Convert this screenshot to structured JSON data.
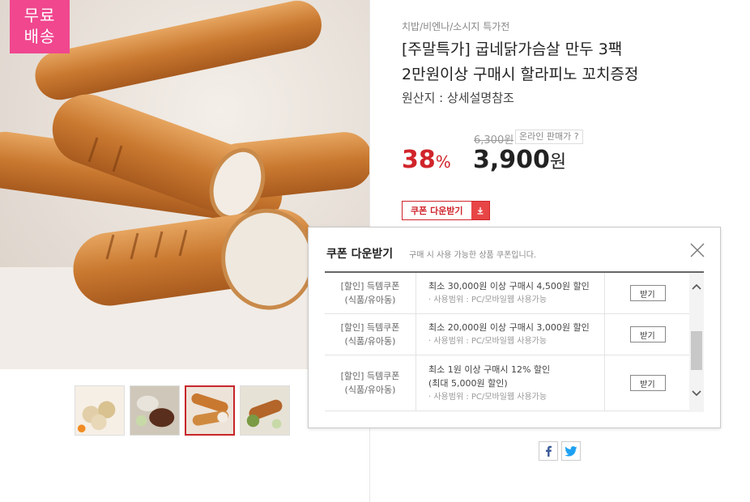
{
  "badge": {
    "free_shipping_line1": "무료",
    "free_shipping_line2": "배송"
  },
  "product": {
    "category": "치밥/비엔나/소시지 특가전",
    "title_line1": "[주말특가] 굽네닭가슴살 만두 3팩",
    "title_line2": "2만원이상 구매시 할라피노 꼬치증정",
    "origin": "원산지 : 상세설명참조",
    "original_price": "6,300원",
    "online_price_label": "온라인 판매가 ?",
    "discount_value": "38",
    "discount_unit": "%",
    "price_value": "3,900",
    "price_unit": "원",
    "coupon_button_label": "쿠폰 다운받기",
    "thumbnails": [
      "thumb-1",
      "thumb-2",
      "thumb-3",
      "thumb-4"
    ],
    "active_thumbnail": 3
  },
  "popup": {
    "title": "쿠폰 다운받기",
    "subtitle": "구매 시 사용 가능한 상품 쿠폰입니다.",
    "coupons": [
      {
        "name_line1": "[할인] 득템쿠폰",
        "name_line2": "(식품/유아동)",
        "desc_line1": "최소 30,000원 이상 구매시 4,500원 할인",
        "desc_line2": "",
        "scope": "· 사용범위 : PC/모바일웹 사용가능",
        "button": "받기"
      },
      {
        "name_line1": "[할인] 득템쿠폰",
        "name_line2": "(식품/유아동)",
        "desc_line1": "최소 20,000원 이상 구매시 3,000원 할인",
        "desc_line2": "",
        "scope": "· 사용범위 : PC/모바일웹 사용가능",
        "button": "받기"
      },
      {
        "name_line1": "[할인] 득템쿠폰",
        "name_line2": "(식품/유아동)",
        "desc_line1": "최소 1원 이상 구매시 12% 할인",
        "desc_line2": "(최대 5,000원 할인)",
        "scope": "· 사용범위 : PC/모바일웹 사용가능",
        "button": "받기"
      }
    ]
  },
  "share": {
    "facebook": "f",
    "twitter": "twitter-bird"
  },
  "colors": {
    "accent_red": "#d0242a",
    "free_ship_pink": "#f0478f"
  }
}
